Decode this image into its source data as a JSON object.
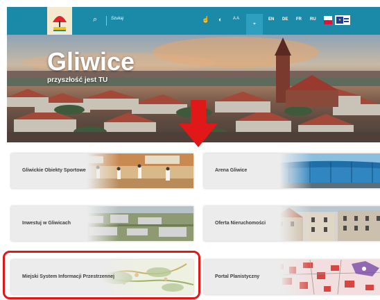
{
  "header": {
    "search_placeholder": "Szukaj",
    "contrast_icon": "contrast-icon",
    "font_size_label": "A A",
    "languages": [
      "EN",
      "DE",
      "FR",
      "RU"
    ],
    "flags": [
      "flag-pl",
      "flag-eu"
    ]
  },
  "hero": {
    "title": "Gliwice",
    "subtitle": "przyszłość jest TU"
  },
  "tiles": [
    {
      "label": "Gliwickie Obiekty Sportowe"
    },
    {
      "label": "Arena Gliwice"
    },
    {
      "label": "Inwestuj w Gliwicach"
    },
    {
      "label": "Oferta Nieruchomości"
    },
    {
      "label": "Miejski System Informacji Przestrzennej"
    },
    {
      "label": "Portal Planistyczny"
    }
  ],
  "colors": {
    "header_bg": "#1b8aa8",
    "annotation_red": "#e01818"
  }
}
